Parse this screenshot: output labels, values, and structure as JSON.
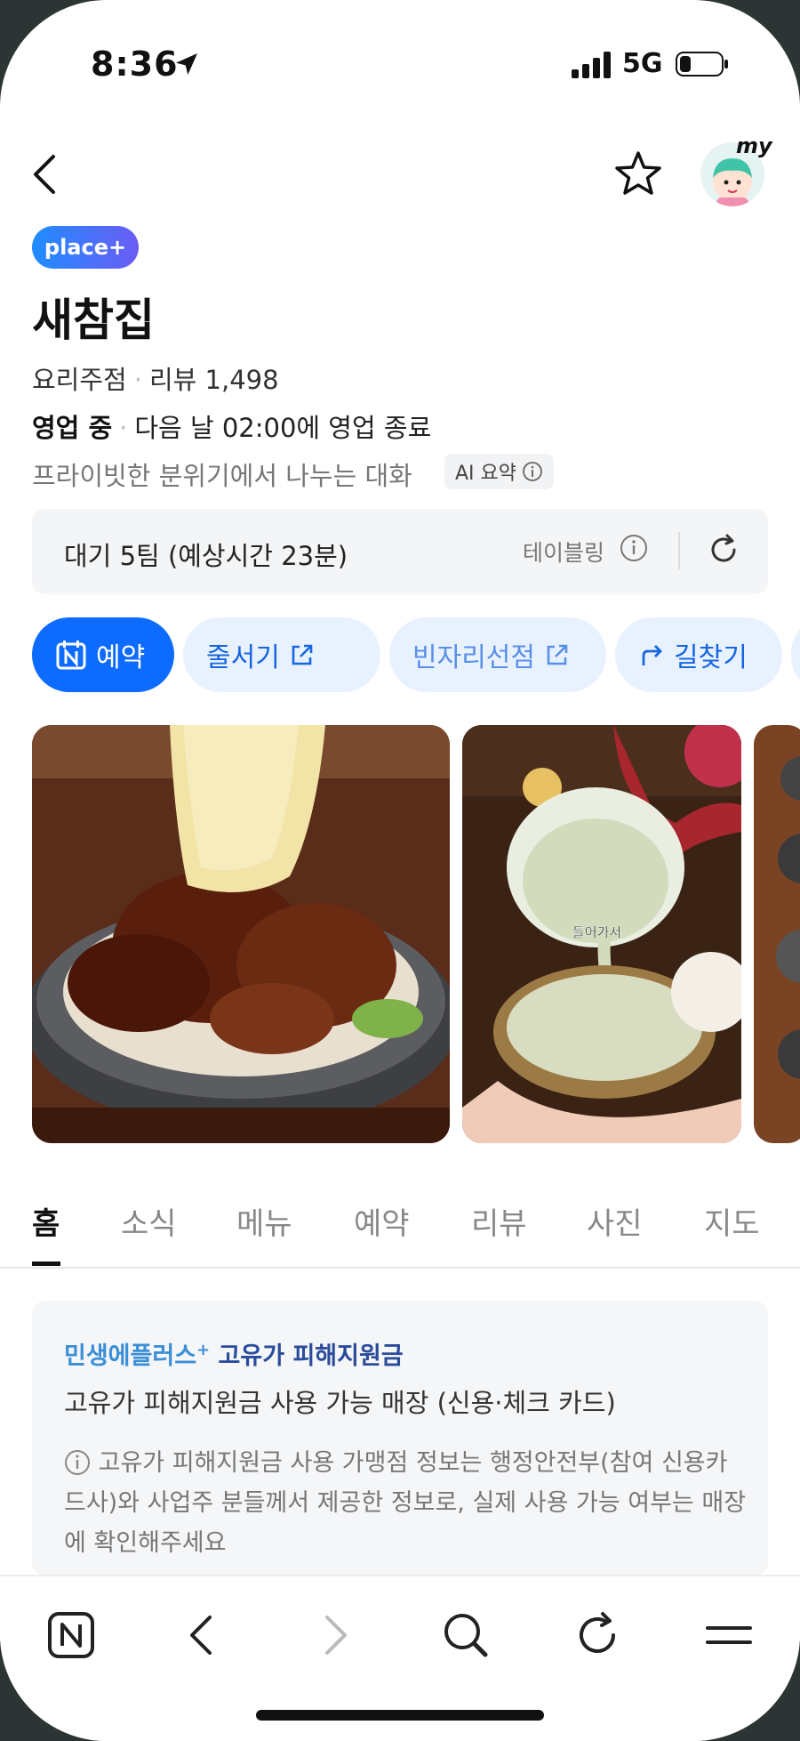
{
  "status": {
    "time": "8:36",
    "network": "5G"
  },
  "header": {
    "avatar_label": "my"
  },
  "place": {
    "badge": "place+",
    "name": "새참집",
    "category": "요리주점",
    "review_label": "리뷰 1,498",
    "status": "영업 중",
    "hours": "다음 날 02:00에 영업 종료",
    "summary": "프라이빗한 분위기에서 나누는 대화",
    "ai_label": "AI 요약"
  },
  "wait": {
    "text_main": "대기 5팀",
    "text_sub": "(예상시간 23분)",
    "provider": "테이블링"
  },
  "actions": [
    {
      "label": "예약"
    },
    {
      "label": "줄서기"
    },
    {
      "label": "빈자리선점"
    },
    {
      "label": "길찾기"
    }
  ],
  "photos": {
    "caption_2": "들어가서"
  },
  "tabs": [
    "홈",
    "소식",
    "메뉴",
    "예약",
    "리뷰",
    "사진",
    "지도"
  ],
  "notice": {
    "brand_1": "민생에플러스",
    "brand_2": "고유가 피해지원금",
    "subtitle": "고유가 피해지원금 사용 가능 매장 (신용·체크 카드)",
    "body": "고유가 피해지원금 사용 가맹점 정보는 행정안전부(참여 신용카드사)와 사업주 분들께서 제공한 정보로, 실제 사용 가능 여부는 매장에 확인해주세요"
  },
  "colors": {
    "primary": "#0d6bff",
    "chip_bg": "#e8f2ff",
    "brand_green": "#03c75a"
  }
}
